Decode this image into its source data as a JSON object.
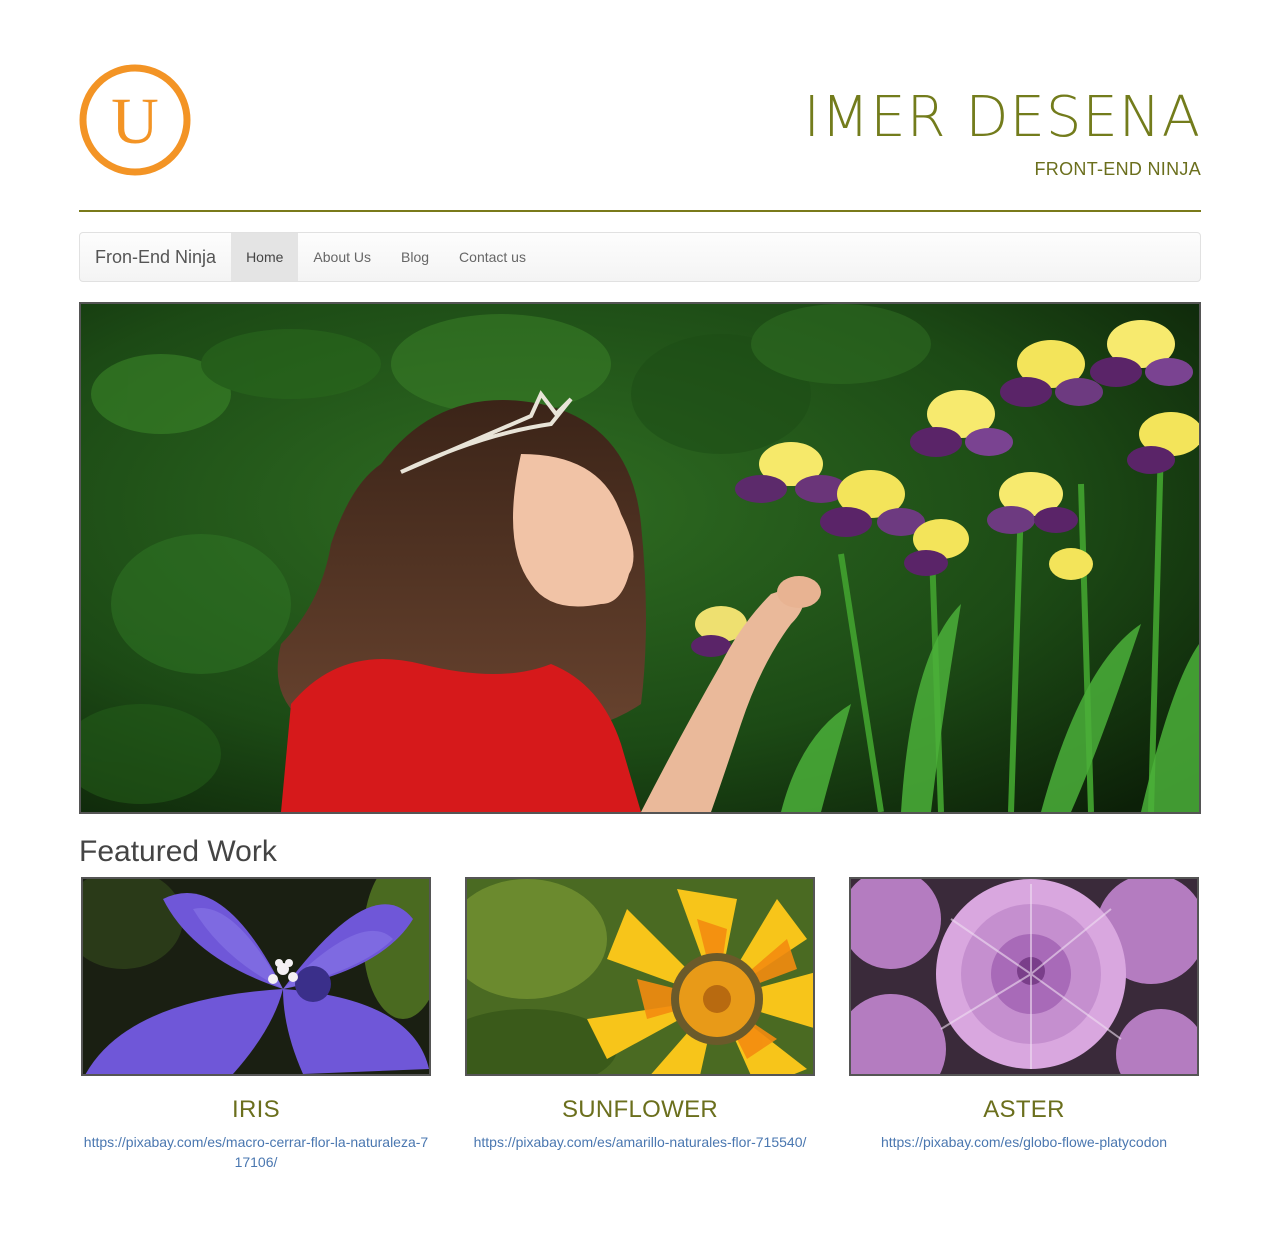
{
  "header": {
    "site_title": "IMER DESENA",
    "site_subtitle": "FRONT-END NINJA",
    "logo_letter": "U",
    "accent_color": "#737c1c",
    "logo_color": "#f39425"
  },
  "navbar": {
    "brand": "Fron-End Ninja",
    "items": [
      {
        "label": "Home",
        "active": true
      },
      {
        "label": "About Us",
        "active": false
      },
      {
        "label": "Blog",
        "active": false
      },
      {
        "label": "Contact us",
        "active": false
      }
    ]
  },
  "hero": {
    "image_icon": "girl-with-iris-flowers-photo"
  },
  "featured": {
    "title": "Featured Work",
    "cards": [
      {
        "title": "IRIS",
        "link": "https://pixabay.com/es/macro-cerrar-flor-la-naturaleza-717106/",
        "image_icon": "purple-flower-photo"
      },
      {
        "title": "SUNFLOWER",
        "link": "https://pixabay.com/es/amarillo-naturales-flor-715540/",
        "image_icon": "yellow-flower-photo"
      },
      {
        "title": "ASTER",
        "link": "https://pixabay.com/es/globo-flowe-platycodon",
        "image_icon": "pink-aster-photo"
      }
    ],
    "link_color": "#4a77b0"
  }
}
